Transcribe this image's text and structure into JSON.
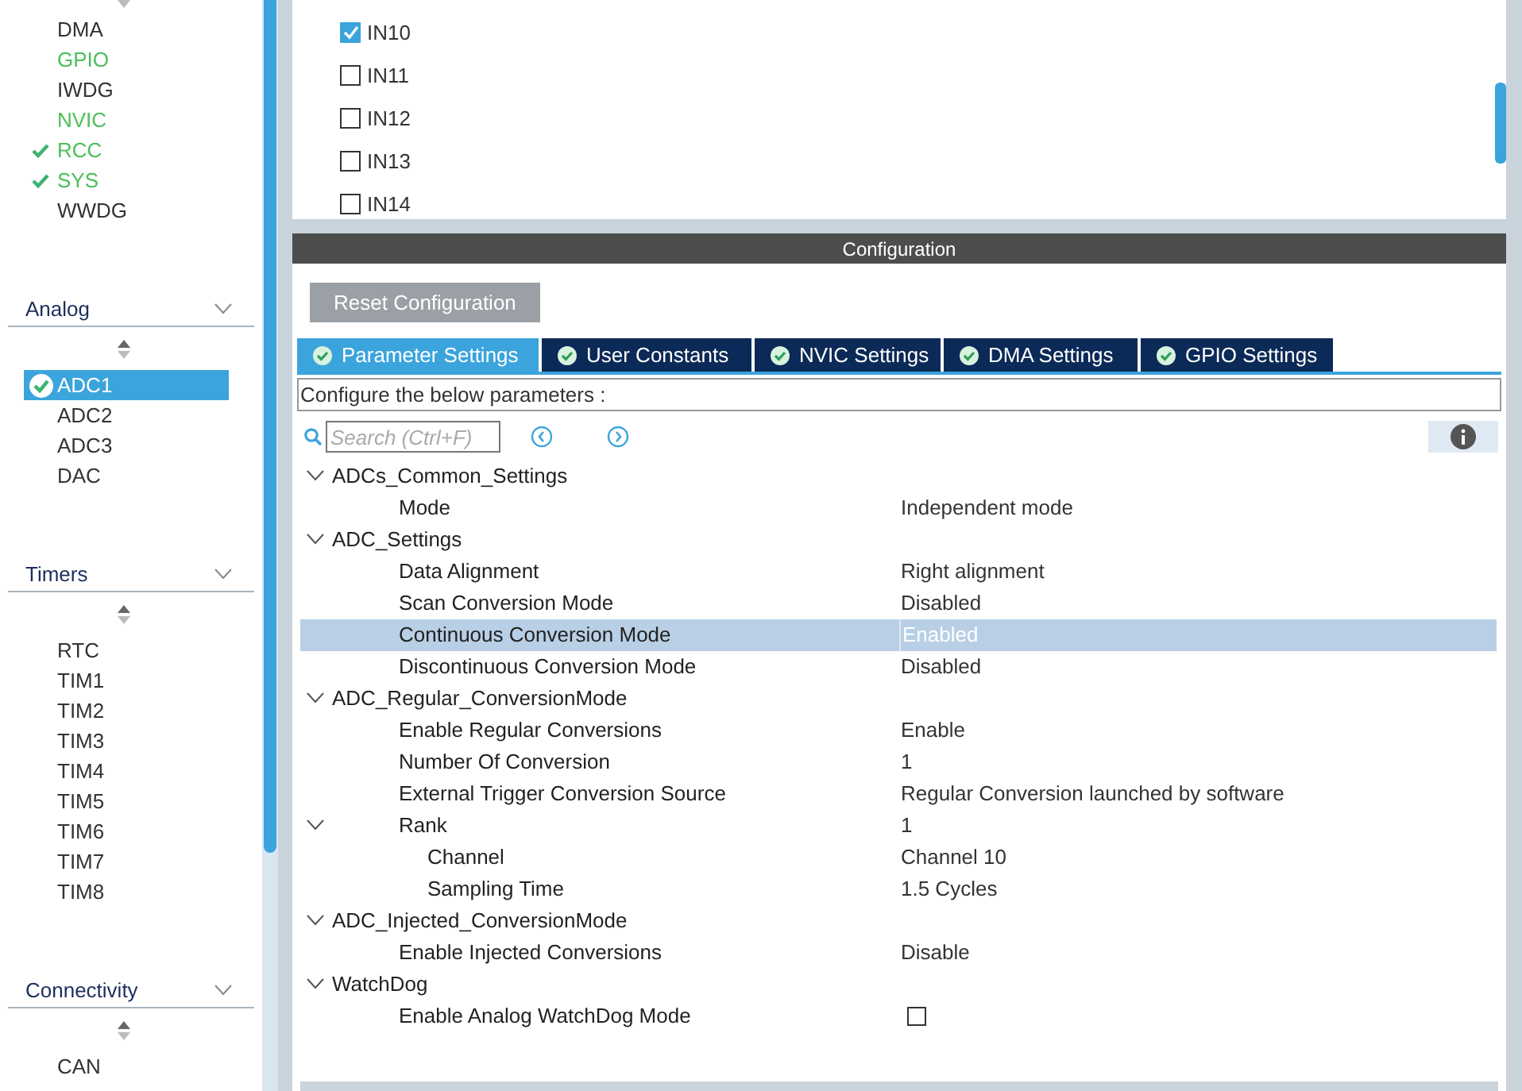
{
  "sidebar": {
    "top_items": [
      {
        "label": "DMA",
        "kind": "plain",
        "selected": false
      },
      {
        "label": "GPIO",
        "kind": "configured",
        "selected": false
      },
      {
        "label": "IWDG",
        "kind": "plain",
        "selected": false
      },
      {
        "label": "NVIC",
        "kind": "configured",
        "selected": false
      },
      {
        "label": "RCC",
        "kind": "checked",
        "selected": false
      },
      {
        "label": "SYS",
        "kind": "checked",
        "selected": false
      },
      {
        "label": "WWDG",
        "kind": "plain",
        "selected": false
      }
    ],
    "categories": [
      {
        "title": "Analog",
        "items": [
          {
            "label": "ADC1",
            "kind": "checked",
            "selected": true
          },
          {
            "label": "ADC2",
            "kind": "plain",
            "selected": false
          },
          {
            "label": "ADC3",
            "kind": "plain",
            "selected": false
          },
          {
            "label": "DAC",
            "kind": "plain",
            "selected": false
          }
        ]
      },
      {
        "title": "Timers",
        "items": [
          {
            "label": "RTC",
            "kind": "plain",
            "selected": false
          },
          {
            "label": "TIM1",
            "kind": "plain",
            "selected": false
          },
          {
            "label": "TIM2",
            "kind": "plain",
            "selected": false
          },
          {
            "label": "TIM3",
            "kind": "plain",
            "selected": false
          },
          {
            "label": "TIM4",
            "kind": "plain",
            "selected": false
          },
          {
            "label": "TIM5",
            "kind": "plain",
            "selected": false
          },
          {
            "label": "TIM6",
            "kind": "plain",
            "selected": false
          },
          {
            "label": "TIM7",
            "kind": "plain",
            "selected": false
          },
          {
            "label": "TIM8",
            "kind": "plain",
            "selected": false
          }
        ]
      },
      {
        "title": "Connectivity",
        "items": [
          {
            "label": "CAN",
            "kind": "plain",
            "selected": false
          }
        ]
      }
    ]
  },
  "channels": [
    {
      "label": "IN10",
      "checked": true
    },
    {
      "label": "IN11",
      "checked": false
    },
    {
      "label": "IN12",
      "checked": false
    },
    {
      "label": "IN13",
      "checked": false
    },
    {
      "label": "IN14",
      "checked": false
    }
  ],
  "configuration": {
    "title": "Configuration",
    "reset_button": "Reset Configuration",
    "tabs": [
      {
        "label": "Parameter Settings",
        "selected": true
      },
      {
        "label": "User Constants",
        "selected": false
      },
      {
        "label": "NVIC Settings",
        "selected": false
      },
      {
        "label": "DMA Settings",
        "selected": false
      },
      {
        "label": "GPIO Settings",
        "selected": false
      }
    ],
    "description": "Configure the below parameters :",
    "search": {
      "placeholder": "Search (Ctrl+F)"
    },
    "parameters": [
      {
        "label": "ADCs_Common_Settings",
        "expanded": true,
        "children": [
          {
            "label": "Mode",
            "kind": "text",
            "value": "Independent mode",
            "selected": false
          }
        ]
      },
      {
        "label": "ADC_Settings",
        "expanded": true,
        "children": [
          {
            "label": "Data Alignment",
            "kind": "text",
            "value": "Right alignment",
            "selected": false
          },
          {
            "label": "Scan Conversion Mode",
            "kind": "text",
            "value": "Disabled",
            "selected": false
          },
          {
            "label": "Continuous Conversion Mode",
            "kind": "text",
            "value": "Enabled",
            "selected": true
          },
          {
            "label": "Discontinuous Conversion Mode",
            "kind": "text",
            "value": "Disabled",
            "selected": false
          }
        ]
      },
      {
        "label": "ADC_Regular_ConversionMode",
        "expanded": true,
        "children": [
          {
            "label": "Enable Regular Conversions",
            "kind": "text",
            "value": "Enable",
            "selected": false
          },
          {
            "label": "Number Of Conversion",
            "kind": "text",
            "value": "1",
            "selected": false
          },
          {
            "label": "External Trigger Conversion Source",
            "kind": "text",
            "value": "Regular Conversion launched by software",
            "selected": false
          },
          {
            "label": "Rank",
            "kind": "text",
            "value": "1",
            "selected": false,
            "expanded": true,
            "children": [
              {
                "label": "Channel",
                "kind": "text",
                "value": "Channel 10",
                "selected": false
              },
              {
                "label": "Sampling Time",
                "kind": "text",
                "value": "1.5 Cycles",
                "selected": false
              }
            ]
          }
        ]
      },
      {
        "label": "ADC_Injected_ConversionMode",
        "expanded": true,
        "children": [
          {
            "label": "Enable Injected Conversions",
            "kind": "text",
            "value": "Disable",
            "selected": false
          }
        ]
      },
      {
        "label": "WatchDog",
        "expanded": true,
        "children": [
          {
            "label": "Enable Analog WatchDog Mode",
            "kind": "checkbox",
            "checked": false,
            "selected": false
          }
        ]
      }
    ]
  }
}
